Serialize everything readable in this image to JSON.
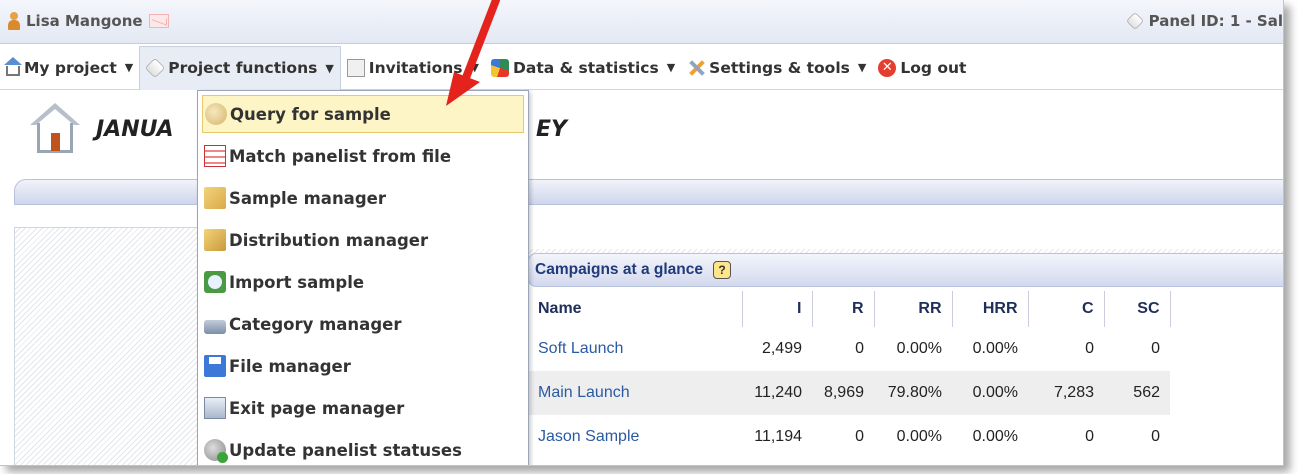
{
  "topbar": {
    "user_name": "Lisa Mangone",
    "panel_id": "Panel ID: 1 - Sal"
  },
  "menu": {
    "items": [
      {
        "label": "My project",
        "icon": "home-icon"
      },
      {
        "label": "Project functions",
        "icon": "hexagon-icon"
      },
      {
        "label": "Invitations",
        "icon": "invitations-icon"
      },
      {
        "label": "Data & statistics",
        "icon": "data-statistics-icon"
      },
      {
        "label": "Settings & tools",
        "icon": "tools-icon"
      },
      {
        "label": "Log out",
        "icon": "logout-icon"
      }
    ],
    "caret": "▼"
  },
  "page": {
    "title_start": "JANUA",
    "title_end": "EY"
  },
  "dropdown": {
    "items": [
      {
        "label": "Query for sample",
        "icon": "query-icon",
        "selected": true
      },
      {
        "label": "Match panelist from file",
        "icon": "match-file-icon"
      },
      {
        "label": "Sample manager",
        "icon": "sample-manager-icon"
      },
      {
        "label": "Distribution manager",
        "icon": "distribution-icon"
      },
      {
        "label": "Import sample",
        "icon": "import-icon"
      },
      {
        "label": "Category manager",
        "icon": "category-icon"
      },
      {
        "label": "File manager",
        "icon": "file-manager-icon"
      },
      {
        "label": "Exit page manager",
        "icon": "exit-page-icon"
      },
      {
        "label": "Update panelist statuses",
        "icon": "update-status-icon"
      }
    ]
  },
  "campaigns": {
    "heading": "Campaigns at a glance",
    "help": "?",
    "columns": [
      "Name",
      "I",
      "R",
      "RR",
      "HRR",
      "C",
      "SC"
    ],
    "rows": [
      {
        "name": "Soft Launch",
        "I": "2,499",
        "R": "0",
        "RR": "0.00%",
        "HRR": "0.00%",
        "C": "0",
        "SC": "0"
      },
      {
        "name": "Main Launch",
        "I": "11,240",
        "R": "8,969",
        "RR": "79.80%",
        "HRR": "0.00%",
        "C": "7,283",
        "SC": "562"
      },
      {
        "name": "Jason Sample",
        "I": "11,194",
        "R": "0",
        "RR": "0.00%",
        "HRR": "0.00%",
        "C": "0",
        "SC": "0"
      }
    ]
  },
  "colors": {
    "link": "#2b5aa3",
    "selected_bg": "#fdf5c5",
    "arrow": "#e3231c"
  }
}
